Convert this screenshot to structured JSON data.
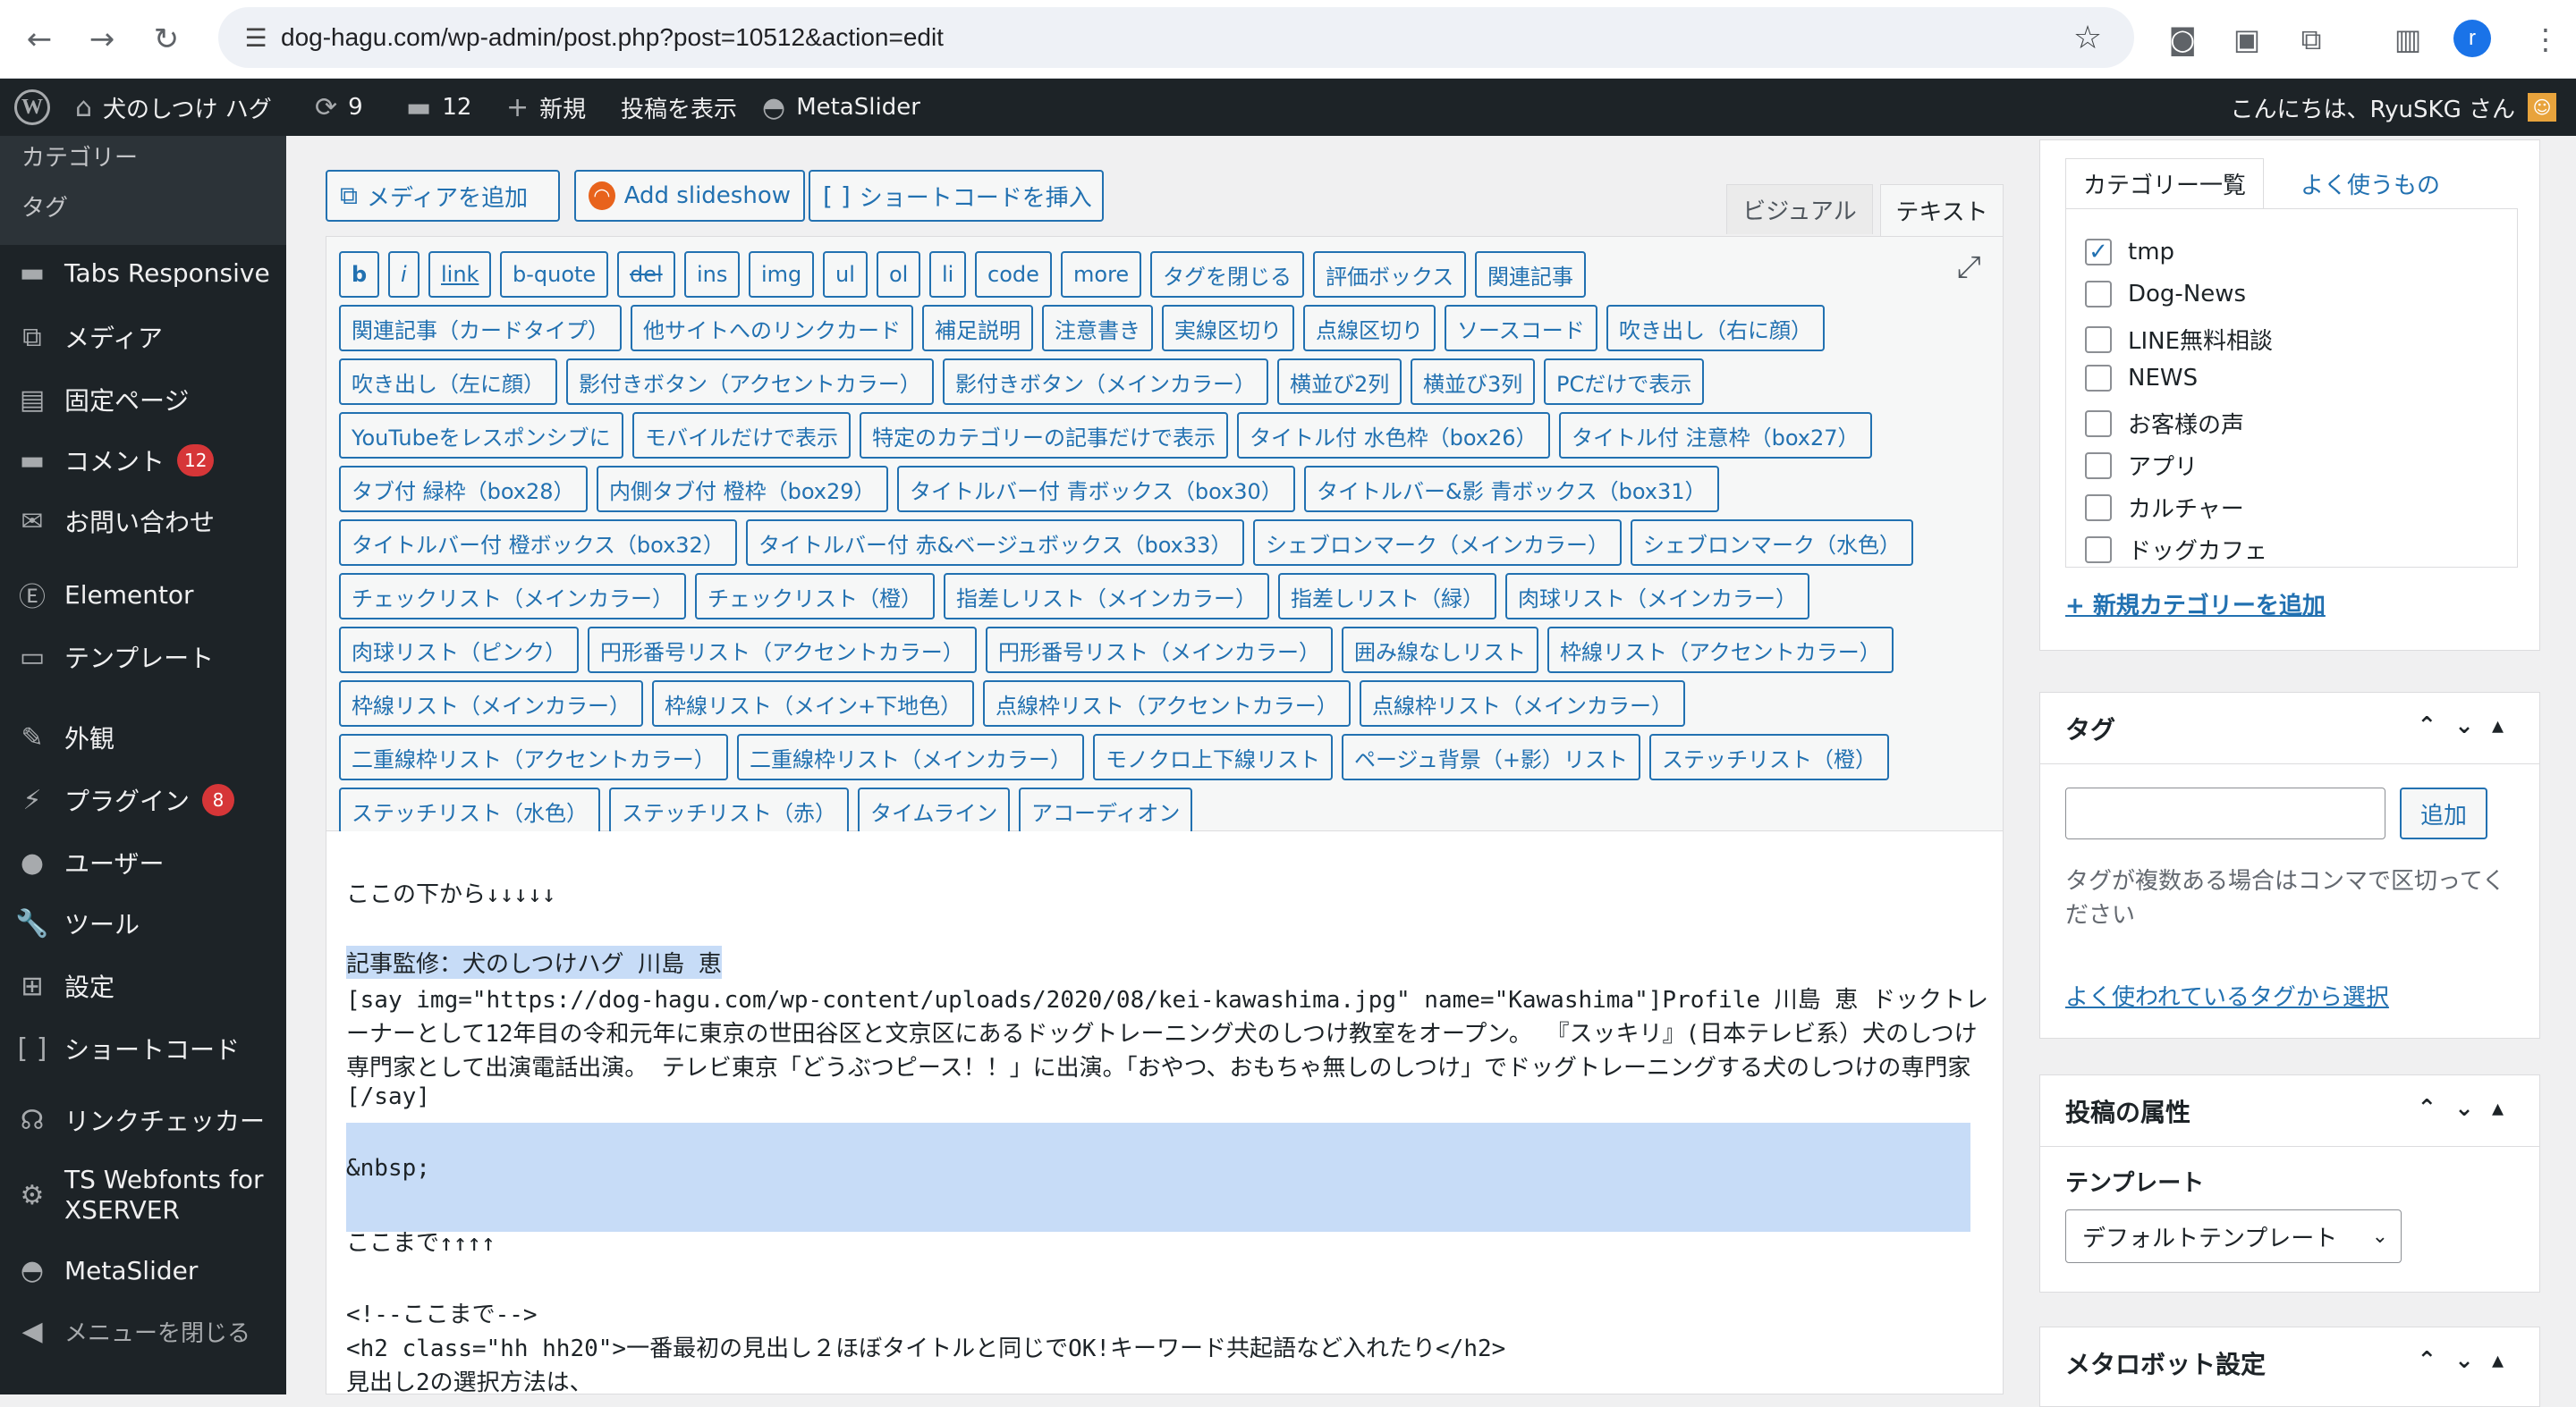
{
  "browser": {
    "url": "dog-hagu.com/wp-admin/post.php?post=10512&action=edit",
    "profile_letter": "r"
  },
  "adminbar": {
    "site_name": "犬のしつけ ハグ",
    "updates_count": "9",
    "comments_count": "12",
    "new_label": "新規",
    "view_post_label": "投稿を表示",
    "metaslider_label": "MetaSlider",
    "greeting": "こんにちは、RyuSKG さん"
  },
  "sidebar": {
    "submenu": [
      "カテゴリー",
      "タグ"
    ],
    "items": [
      {
        "label": "Tabs Responsive",
        "icon": "folder-icon"
      },
      {
        "label": "メディア",
        "icon": "media-icon"
      },
      {
        "label": "固定ページ",
        "icon": "pages-icon"
      },
      {
        "label": "コメント",
        "icon": "comment-icon",
        "badge": "12"
      },
      {
        "label": "お問い合わせ",
        "icon": "mail-icon"
      },
      {
        "label": "Elementor",
        "icon": "elementor-icon"
      },
      {
        "label": "テンプレート",
        "icon": "folder-open-icon"
      },
      {
        "label": "外観",
        "icon": "brush-icon"
      },
      {
        "label": "プラグイン",
        "icon": "plugin-icon",
        "badge": "8"
      },
      {
        "label": "ユーザー",
        "icon": "user-icon"
      },
      {
        "label": "ツール",
        "icon": "wrench-icon"
      },
      {
        "label": "設定",
        "icon": "settings-icon"
      },
      {
        "label": "ショートコード",
        "icon": "brackets-icon"
      },
      {
        "label": "リンクチェッカー",
        "icon": "link-checker-icon"
      },
      {
        "label": "TS Webfonts for XSERVER",
        "icon": "gear-icon"
      },
      {
        "label": "MetaSlider",
        "icon": "metaslider-icon"
      },
      {
        "label": "メニューを閉じる",
        "icon": "collapse-icon"
      }
    ]
  },
  "editor": {
    "add_media": "メディアを追加",
    "add_slideshow": "Add slideshow",
    "insert_shortcode": "ショートコードを挿入",
    "tab_visual": "ビジュアル",
    "tab_text": "テキスト",
    "quicktags": [
      "b",
      "i",
      "link",
      "b-quote",
      "del",
      "ins",
      "img",
      "ul",
      "ol",
      "li",
      "code",
      "more",
      "タグを閉じる",
      "評価ボックス",
      "関連記事",
      "関連記事（カードタイプ）",
      "他サイトへのリンクカード",
      "補足説明",
      "注意書き",
      "実線区切り",
      "点線区切り",
      "ソースコード",
      "吹き出し（右に顔）",
      "吹き出し（左に顔）",
      "影付きボタン（アクセントカラー）",
      "影付きボタン（メインカラー）",
      "横並び2列",
      "横並び3列",
      "PCだけで表示",
      "YouTubeをレスポンシブに",
      "モバイルだけで表示",
      "特定のカテゴリーの記事だけで表示",
      "タイトル付 水色枠（box26）",
      "タイトル付 注意枠（box27）",
      "タブ付 緑枠（box28）",
      "内側タブ付 橙枠（box29）",
      "タイトルバー付 青ボックス（box30）",
      "タイトルバー&影 青ボックス（box31）",
      "タイトルバー付 橙ボックス（box32）",
      "タイトルバー付 赤&ベージュボックス（box33）",
      "シェブロンマーク（メインカラー）",
      "シェブロンマーク（水色）",
      "チェックリスト（メインカラー）",
      "チェックリスト（橙）",
      "指差しリスト（メインカラー）",
      "指差しリスト（緑）",
      "肉球リスト（メインカラー）",
      "肉球リスト（ピンク）",
      "円形番号リスト（アクセントカラー）",
      "円形番号リスト（メインカラー）",
      "囲み線なしリスト",
      "枠線リスト（アクセントカラー）",
      "枠線リスト（メインカラー）",
      "枠線リスト（メイン+下地色）",
      "点線枠リスト（アクセントカラー）",
      "点線枠リスト（メインカラー）",
      "二重線枠リスト（アクセントカラー）",
      "二重線枠リスト（メインカラー）",
      "モノクロ上下線リスト",
      "ページュ背景（+影）リスト",
      "ステッチリスト（橙）",
      "ステッチリスト（水色）",
      "ステッチリスト（赤）",
      "タイムライン",
      "アコーディオン"
    ],
    "lines": [
      "ここの下から↓↓↓↓↓",
      "記事監修：犬のしつけハグ 川島 恵",
      "[say img=\"https://dog-hagu.com/wp-content/uploads/2020/08/kei-kawashima.jpg\" name=\"Kawashima\"]Profile 川島 恵 ドックトレ",
      "ーナーとして12年目の令和元年に東京の世田谷区と文京区にあるドッグトレーニング犬のしつけ教室をオープン。 『スッキリ』(日本テレビ系）犬のしつけ",
      "専門家として出演電話出演。 テレビ東京「どうぶつピース！！」に出演。「おやつ、おもちゃ無しのしつけ」でドッグトレーニングする犬のしつけの専門家",
      "[/say]",
      "&nbsp;",
      "ここまで↑↑↑↑",
      "<!--ここまで-->",
      "<h2 class=\"hh hh20\">一番最初の見出し２ほぼタイトルと同じでOK!キーワード共起語など入れたり</h2>",
      "見出し2の選択方法は、"
    ]
  },
  "categories": {
    "tab_all": "カテゴリー一覧",
    "tab_popular": "よく使うもの",
    "items": [
      {
        "label": "tmp",
        "checked": true
      },
      {
        "label": "Dog-News",
        "checked": false
      },
      {
        "label": "LINE無料相談",
        "checked": false
      },
      {
        "label": "NEWS",
        "checked": false
      },
      {
        "label": "お客様の声",
        "checked": false
      },
      {
        "label": "アプリ",
        "checked": false
      },
      {
        "label": "カルチャー",
        "checked": false
      },
      {
        "label": "ドッグカフェ",
        "checked": false
      }
    ],
    "add_new": "+ 新規カテゴリーを追加"
  },
  "tags": {
    "title": "タグ",
    "add_button": "追加",
    "help": [
      "タグが複数ある場合はコンマで区切ってく",
      "ださい"
    ],
    "choose_link": "よく使われているタグから選択"
  },
  "post_attributes": {
    "title": "投稿の属性",
    "template_label": "テンプレート",
    "template_value": "デフォルトテンプレート"
  },
  "metarobots": {
    "title": "メタロボット設定"
  },
  "colors": {
    "accent": "#2271b1",
    "adminbar_bg": "#1d2327",
    "highlight": "#c7dcf7",
    "badge": "#d63638"
  }
}
